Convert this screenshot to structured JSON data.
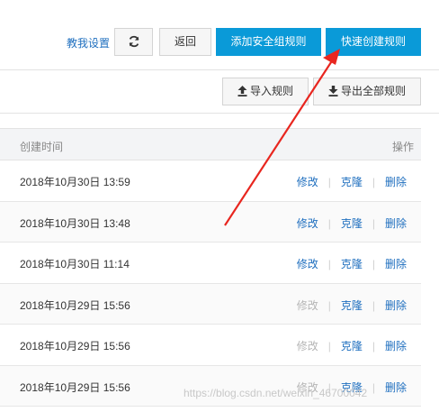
{
  "toolbar": {
    "help_link": "教我设置",
    "back_label": "返回",
    "add_rule_label": "添加安全组规则",
    "quick_create_label": "快速创建规则",
    "refresh_icon": "refresh-icon"
  },
  "subtoolbar": {
    "import_label": "导入规则",
    "export_label": "导出全部规则",
    "import_icon": "upload-icon",
    "export_icon": "download-icon"
  },
  "table": {
    "headers": {
      "created_time": "创建时间",
      "actions": "操作"
    },
    "action_labels": {
      "edit": "修改",
      "clone": "克隆",
      "delete": "删除"
    },
    "rows": [
      {
        "created_time": "2018年10月30日 13:59",
        "edit_enabled": true
      },
      {
        "created_time": "2018年10月30日 13:48",
        "edit_enabled": true
      },
      {
        "created_time": "2018年10月30日 11:14",
        "edit_enabled": true
      },
      {
        "created_time": "2018年10月29日 15:56",
        "edit_enabled": false
      },
      {
        "created_time": "2018年10月29日 15:56",
        "edit_enabled": false
      },
      {
        "created_time": "2018年10月29日 15:56",
        "edit_enabled": false
      }
    ]
  },
  "annotation": {
    "arrow_color": "#e8261f"
  },
  "watermark": {
    "text": "https://blog.csdn.net/weixin_46700042"
  },
  "colors": {
    "primary": "#0a9ad8",
    "link": "#1f6fbf",
    "disabled": "#b5b5b5"
  }
}
